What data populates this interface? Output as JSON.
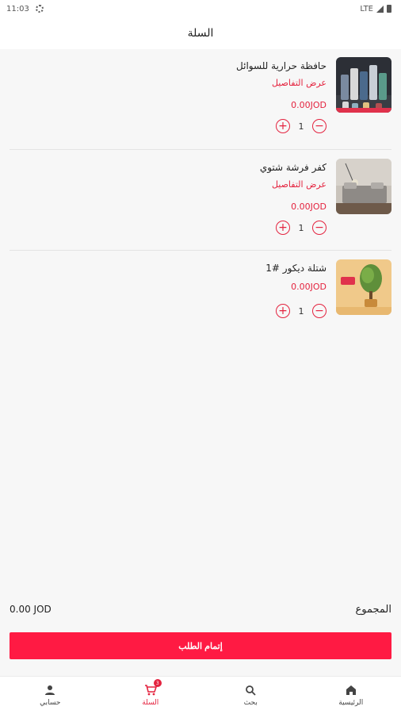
{
  "status_bar": {
    "time": "11:03",
    "network": "LTE"
  },
  "app_bar": {
    "title": "السلة"
  },
  "cart": {
    "items": [
      {
        "name": "حافظة حرارية للسوائل",
        "details_link": "عرض التفاصيل",
        "price": "0.00JOD",
        "quantity": "1",
        "thumb_icon": "thermos-bottles"
      },
      {
        "name": "كفر فرشة شتوي",
        "details_link": "عرض التفاصيل",
        "price": "0.00JOD",
        "quantity": "1",
        "thumb_icon": "bed-cover"
      },
      {
        "name": "شتلة ديكور #1",
        "details_link": "",
        "price": "0.00JOD",
        "quantity": "1",
        "thumb_icon": "decor-plant"
      }
    ],
    "total_label": "المجموع",
    "total_amount": "0.00 JOD",
    "checkout_label": "إتمام الطلب"
  },
  "bottom_nav": {
    "items": [
      {
        "label": "الرئيسية",
        "icon": "home-icon"
      },
      {
        "label": "بحث",
        "icon": "search-icon"
      },
      {
        "label": "السلة",
        "icon": "cart-icon",
        "badge": "3",
        "active": true
      },
      {
        "label": "حسابي",
        "icon": "person-icon"
      }
    ]
  },
  "colors": {
    "accent": "#e4233f",
    "button": "#ff1a43",
    "background": "#f7f7f7"
  }
}
